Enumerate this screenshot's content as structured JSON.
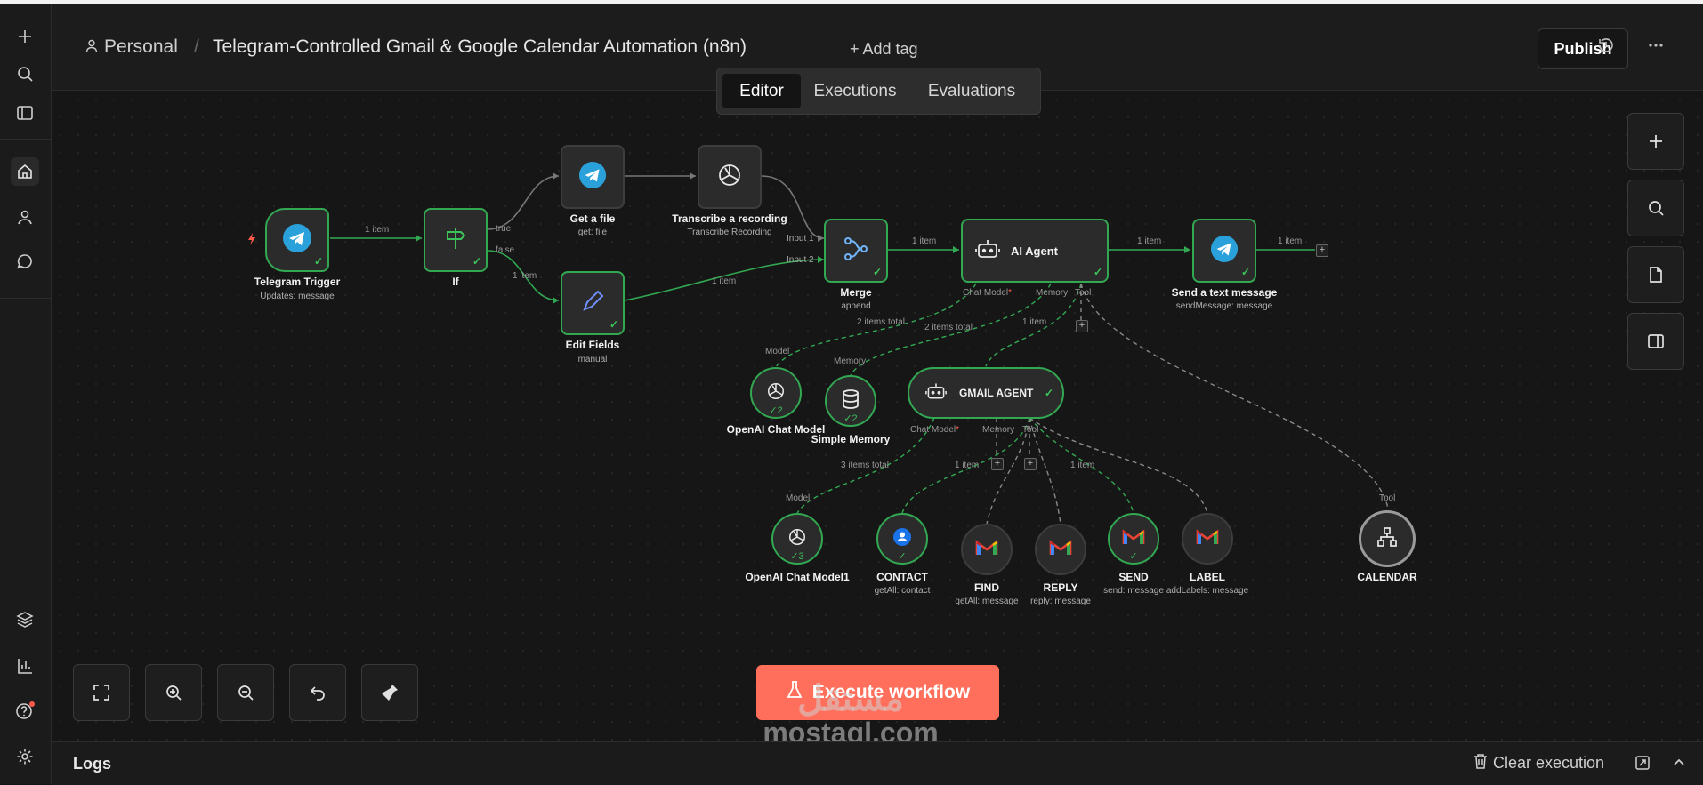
{
  "header": {
    "project": "Personal",
    "separator": "/",
    "workflow_title": "Telegram-Controlled Gmail & Google Calendar Automation (n8n)",
    "add_tag": "+ Add tag",
    "publish": "Publish"
  },
  "tabs": [
    {
      "label": "Editor",
      "active": true
    },
    {
      "label": "Executions",
      "active": false
    },
    {
      "label": "Evaluations",
      "active": false
    }
  ],
  "sidebar": {
    "icons": [
      "plus-icon",
      "search-icon",
      "panel-icon",
      "home-icon",
      "user-icon",
      "chat-icon",
      "templates-icon",
      "insights-icon",
      "help-icon",
      "settings-icon"
    ]
  },
  "nodes": {
    "telegram_trigger": {
      "label": "Telegram Trigger",
      "sub": "Updates: message"
    },
    "if": {
      "label": "If",
      "sub": ""
    },
    "get_file": {
      "label": "Get a file",
      "sub": "get: file"
    },
    "transcribe": {
      "label": "Transcribe a recording",
      "sub": "Transcribe Recording"
    },
    "edit_fields": {
      "label": "Edit Fields",
      "sub": "manual"
    },
    "merge": {
      "label": "Merge",
      "sub": "append",
      "in1": "Input 1",
      "in2": "Input 2"
    },
    "ai_agent": {
      "label": "AI Agent"
    },
    "send_text": {
      "label": "Send a text message",
      "sub": "sendMessage: message"
    },
    "openai_chat": {
      "label": "OpenAI Chat Model",
      "count": "2"
    },
    "simple_memory": {
      "label": "Simple Memory",
      "count": "2"
    },
    "gmail_agent": {
      "label": "GMAIL AGENT"
    },
    "openai_chat1": {
      "label": "OpenAI Chat Model1",
      "count": "3"
    },
    "contact": {
      "label": "CONTACT",
      "sub": "getAll: contact"
    },
    "find": {
      "label": "FIND",
      "sub": "getAll: message"
    },
    "reply": {
      "label": "REPLY",
      "sub": "reply: message"
    },
    "send": {
      "label": "SEND",
      "sub": "send: message"
    },
    "label": {
      "label": "LABEL",
      "sub": "addLabels: message"
    },
    "calendar": {
      "label": "CALENDAR"
    }
  },
  "edge_labels": {
    "trigger_if": "1 item",
    "if_true": "true",
    "if_false": "false",
    "false_edit": "1 item",
    "edit_merge": "1 item",
    "merge_agent": "1 item",
    "agent_send": "1 item",
    "send_out": "1 item",
    "model_total": "2 items total",
    "memory_total": "2 items total",
    "tool_item": "1 item",
    "gmail_model_total": "3 items total",
    "gmail_tool_item1": "1 item",
    "gmail_tool_item2": "1 item"
  },
  "ports": {
    "chat_model": "Chat Model",
    "required": "*",
    "memory": "Memory",
    "tool": "Tool",
    "model": "Model"
  },
  "canvas": {
    "execute": "Execute workflow"
  },
  "logs": {
    "title": "Logs",
    "clear": "Clear execution"
  },
  "watermark": {
    "arabic": "مستقل",
    "text": "mostaql.com"
  },
  "colors": {
    "accent_green": "#32a852",
    "execute_btn": "#ff6f5c",
    "telegram_blue": "#2aa1da",
    "background": "#161616"
  }
}
